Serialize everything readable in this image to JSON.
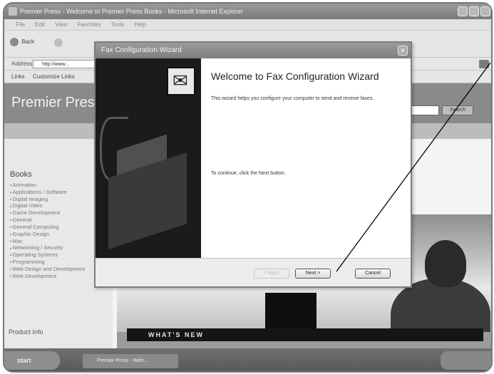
{
  "browser": {
    "title": "Premier Press - Welcome to Premier Press Books - Microsoft Internet Explorer",
    "menu": [
      "File",
      "Edit",
      "View",
      "Favorites",
      "Tools",
      "Help"
    ],
    "back_label": "Back",
    "address_label": "Address",
    "address_value": "http://www...",
    "links_label": "Links",
    "links_item": "Customize Links"
  },
  "site": {
    "title": "Premier Press",
    "search_button": "Search",
    "books_heading": "Books",
    "book_categories": [
      "Animation",
      "Applications / Software",
      "Digital Imaging",
      "Digital Video",
      "Game Development",
      "General",
      "General Computing",
      "Graphic Design",
      "Mac",
      "Networking / Security",
      "Operating Systems",
      "Programming",
      "Web Design and Development",
      "Web Development"
    ],
    "product_info": "Product Info",
    "banner": "WHAT'S NEW"
  },
  "wizard": {
    "title": "Fax Configuration Wizard",
    "heading": "Welcome to Fax Configuration Wizard",
    "description": "This wizard helps you configure your computer to send and receive faxes.",
    "continue_text": "To continue, click the Next button.",
    "back_button": "< Back",
    "next_button": "Next >",
    "cancel_button": "Cancel"
  },
  "taskbar": {
    "start": "start",
    "task": "Premier Press - Welc..."
  },
  "colors": {
    "title_bar": "#8a8a8a",
    "dialog_left_panel": "#1b1b1b",
    "dialog_body": "#ffffff"
  }
}
